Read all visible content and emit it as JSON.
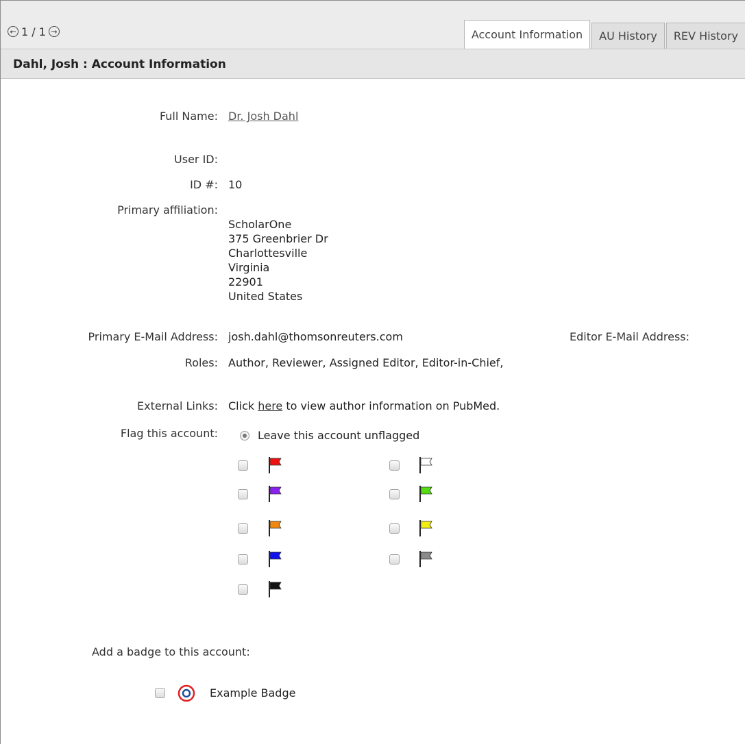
{
  "pager": {
    "text": "1 / 1",
    "prev_glyph": "←",
    "next_glyph": "→"
  },
  "tabs": [
    {
      "label": "Account Information",
      "active": true
    },
    {
      "label": "AU History",
      "active": false
    },
    {
      "label": "REV History",
      "active": false
    }
  ],
  "section_title": "Dahl, Josh : Account Information",
  "fields": {
    "full_name_label": "Full Name:",
    "full_name_value": "Dr. Josh Dahl",
    "user_id_label": "User ID:",
    "user_id_value": "",
    "id_label": "ID #:",
    "id_value": "10",
    "affiliation_label": "Primary affiliation:",
    "affiliation_lines": [
      "ScholarOne",
      "375 Greenbrier Dr",
      "Charlottesville",
      "Virginia",
      "22901",
      "United States"
    ],
    "email_label": "Primary E-Mail Address:",
    "email_value": "josh.dahl@thomsonreuters.com",
    "editor_email_label": "Editor E-Mail Address:",
    "roles_label": "Roles:",
    "roles_value": "Author, Reviewer, Assigned Editor, Editor-in-Chief,",
    "external_links_label": "External Links:",
    "external_links_pre": "Click ",
    "external_links_link": "here",
    "external_links_post": " to view author information on PubMed."
  },
  "flag_section": {
    "label": "Flag this account:",
    "unflagged_label": "Leave this account unflagged",
    "flags": [
      {
        "color": "#ee1111",
        "icon": "red-flag-icon"
      },
      {
        "color": "#ffffff",
        "icon": "white-flag-icon"
      },
      {
        "color": "#8a22ee",
        "icon": "purple-flag-icon"
      },
      {
        "color": "#55dd11",
        "icon": "green-flag-icon"
      },
      {
        "color": "#ee8811",
        "icon": "orange-flag-icon"
      },
      {
        "color": "#f2ee11",
        "icon": "yellow-flag-icon"
      },
      {
        "color": "#1111ee",
        "icon": "blue-flag-icon"
      },
      {
        "color": "#8a8a8a",
        "icon": "gray-flag-icon"
      },
      {
        "color": "#111111",
        "icon": "black-flag-icon"
      }
    ]
  },
  "badge_section": {
    "label": "Add a badge to this account:",
    "badge_name": "Example Badge",
    "badge_ring_color": "#e02020",
    "badge_inner_color": "#1a4fa0"
  }
}
